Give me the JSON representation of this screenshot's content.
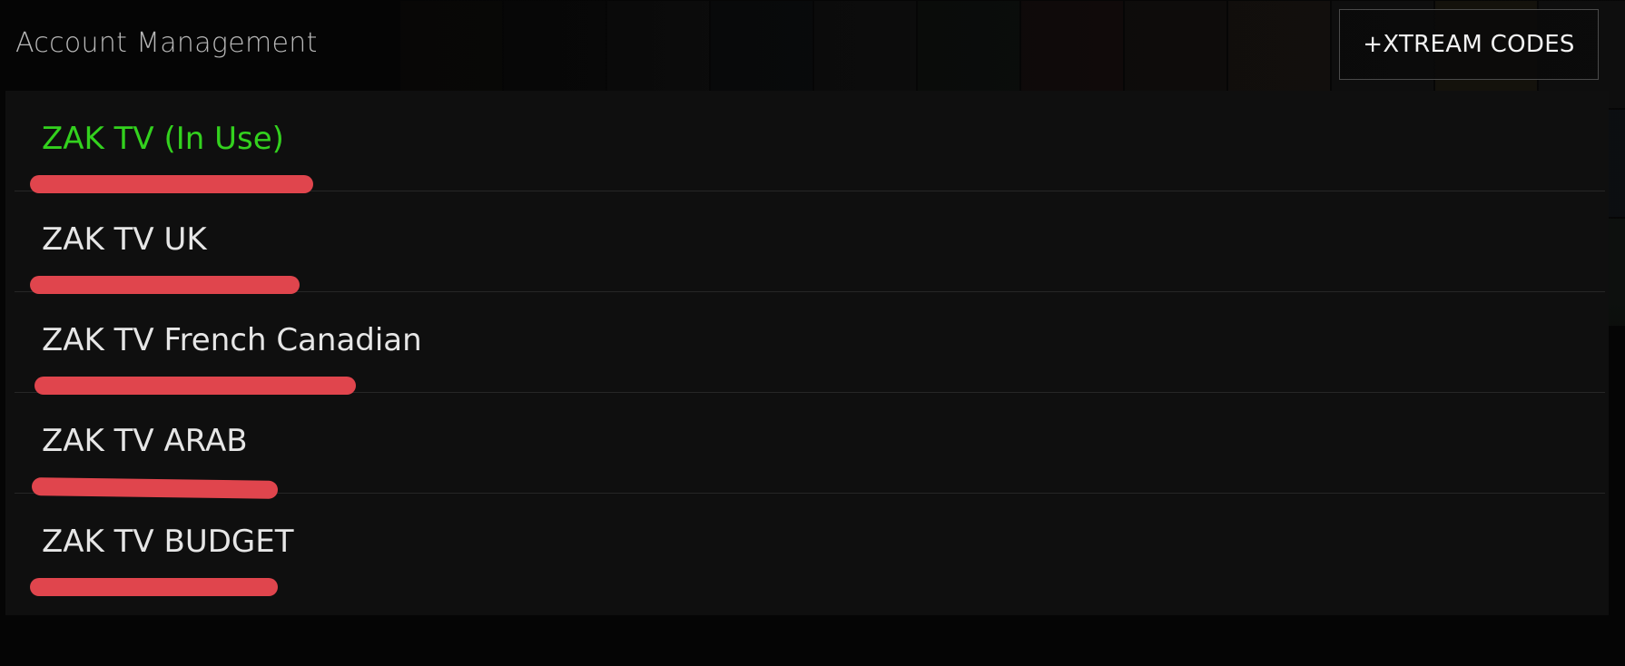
{
  "header": {
    "title": "Account Management"
  },
  "xtream_button": {
    "label": "+XTREAM CODES"
  },
  "accounts": [
    {
      "name": "ZAK TV (In Use)",
      "in_use": true,
      "subtitle": "",
      "subtitle_redacted": true
    },
    {
      "name": "ZAK TV UK",
      "in_use": false,
      "subtitle": "",
      "subtitle_redacted": true
    },
    {
      "name": "ZAK TV French Canadian",
      "in_use": false,
      "subtitle": "",
      "subtitle_redacted": true
    },
    {
      "name": "ZAK TV ARAB",
      "in_use": false,
      "subtitle": "",
      "subtitle_redacted": true
    },
    {
      "name": "ZAK TV BUDGET",
      "in_use": false,
      "subtitle": "",
      "subtitle_redacted": true
    }
  ],
  "colors": {
    "in_use": "#33d11e",
    "redaction": "#e0454d",
    "background": "#050505"
  }
}
